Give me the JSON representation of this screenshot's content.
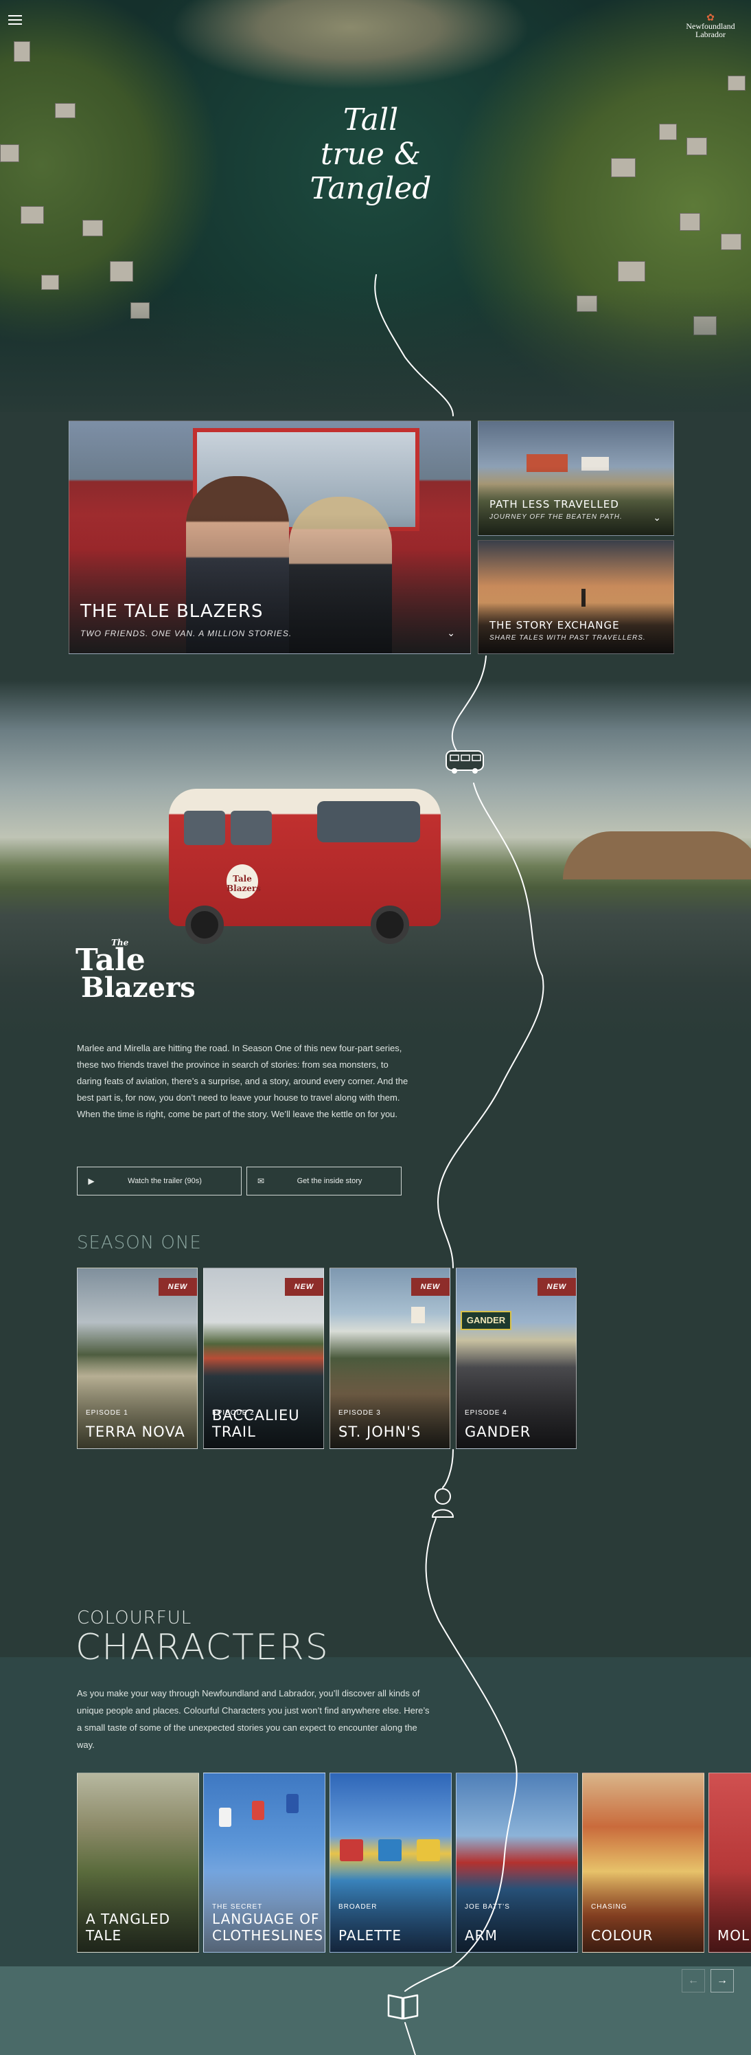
{
  "brand": {
    "name": "Newfoundland Labrador"
  },
  "hero": {
    "title_lines": [
      "Tall",
      "true &",
      "Tangled"
    ]
  },
  "features": {
    "main": {
      "title": "THE TALE BLAZERS",
      "subtitle": "TWO FRIENDS. ONE VAN. A MILLION STORIES."
    },
    "path": {
      "title": "PATH LESS TRAVELLED",
      "subtitle": "JOURNEY OFF THE BEATEN PATH."
    },
    "story": {
      "title": "THE STORY EXCHANGE",
      "subtitle": "SHARE TALES WITH PAST TRAVELLERS."
    }
  },
  "show": {
    "logo_the": "The",
    "logo_line1": "Tale",
    "logo_line2": "Blazers",
    "van_decal": "Tale Blazers",
    "description": "Marlee and Mirella are hitting the road. In Season One of this new four-part series, these two friends travel the province in search of stories: from sea monsters, to daring feats of aviation, there’s a surprise, and a story, around every corner. And the best part is, for now, you don’t need to leave your house to travel along with them. When the time is right, come be part of the story. We’ll leave the kettle on for you.",
    "buttons": {
      "trailer": "Watch the trailer (90s)",
      "inside": "Get the inside story"
    }
  },
  "season": {
    "heading": "SEASON ONE",
    "episodes": [
      {
        "badge": "NEW",
        "number": "EPISODE 1",
        "title": "TERRA NOVA"
      },
      {
        "badge": "NEW",
        "number": "EPISODE 2",
        "title": "BACCALIEU TRAIL"
      },
      {
        "badge": "NEW",
        "number": "EPISODE 3",
        "title": "ST. JOHN'S"
      },
      {
        "badge": "NEW",
        "number": "EPISODE 4",
        "title": "GANDER"
      }
    ],
    "gander_sign": "GANDER"
  },
  "characters": {
    "heading_small": "COLOURFUL",
    "heading_big": "CHARACTERS",
    "description": "As you make your way through Newfoundland and Labrador, you’ll discover all kinds of unique people and places. Colourful Characters you just won’t find anywhere else. Here’s a small taste of some of the unexpected stories you can expect to encounter along the way.",
    "cards": [
      {
        "kicker": "",
        "title": "A TANGLED TALE"
      },
      {
        "kicker": "THE SECRET",
        "title": "LANGUAGE OF CLOTHESLINES"
      },
      {
        "kicker": "BROADER",
        "title": "PALETTE"
      },
      {
        "kicker": "JOE BATT’S",
        "title": "ARM"
      },
      {
        "kicker": "CHASING",
        "title": "COLOUR"
      },
      {
        "kicker": "",
        "title": "MOLL"
      }
    ],
    "nav": {
      "prev": "←",
      "next": "→"
    }
  },
  "icons": {
    "menu": "hamburger-icon",
    "van": "van-icon",
    "storyteller": "storyteller-icon",
    "book": "book-icon",
    "play": "play-icon",
    "mail": "mail-icon",
    "chevron": "chevron-down-icon"
  },
  "colors": {
    "background": "#2a3b38",
    "badge": "#8e2d2a",
    "accent_text": "#8ea8a2",
    "band": "#2f4746",
    "footer": "#4a6a68"
  }
}
